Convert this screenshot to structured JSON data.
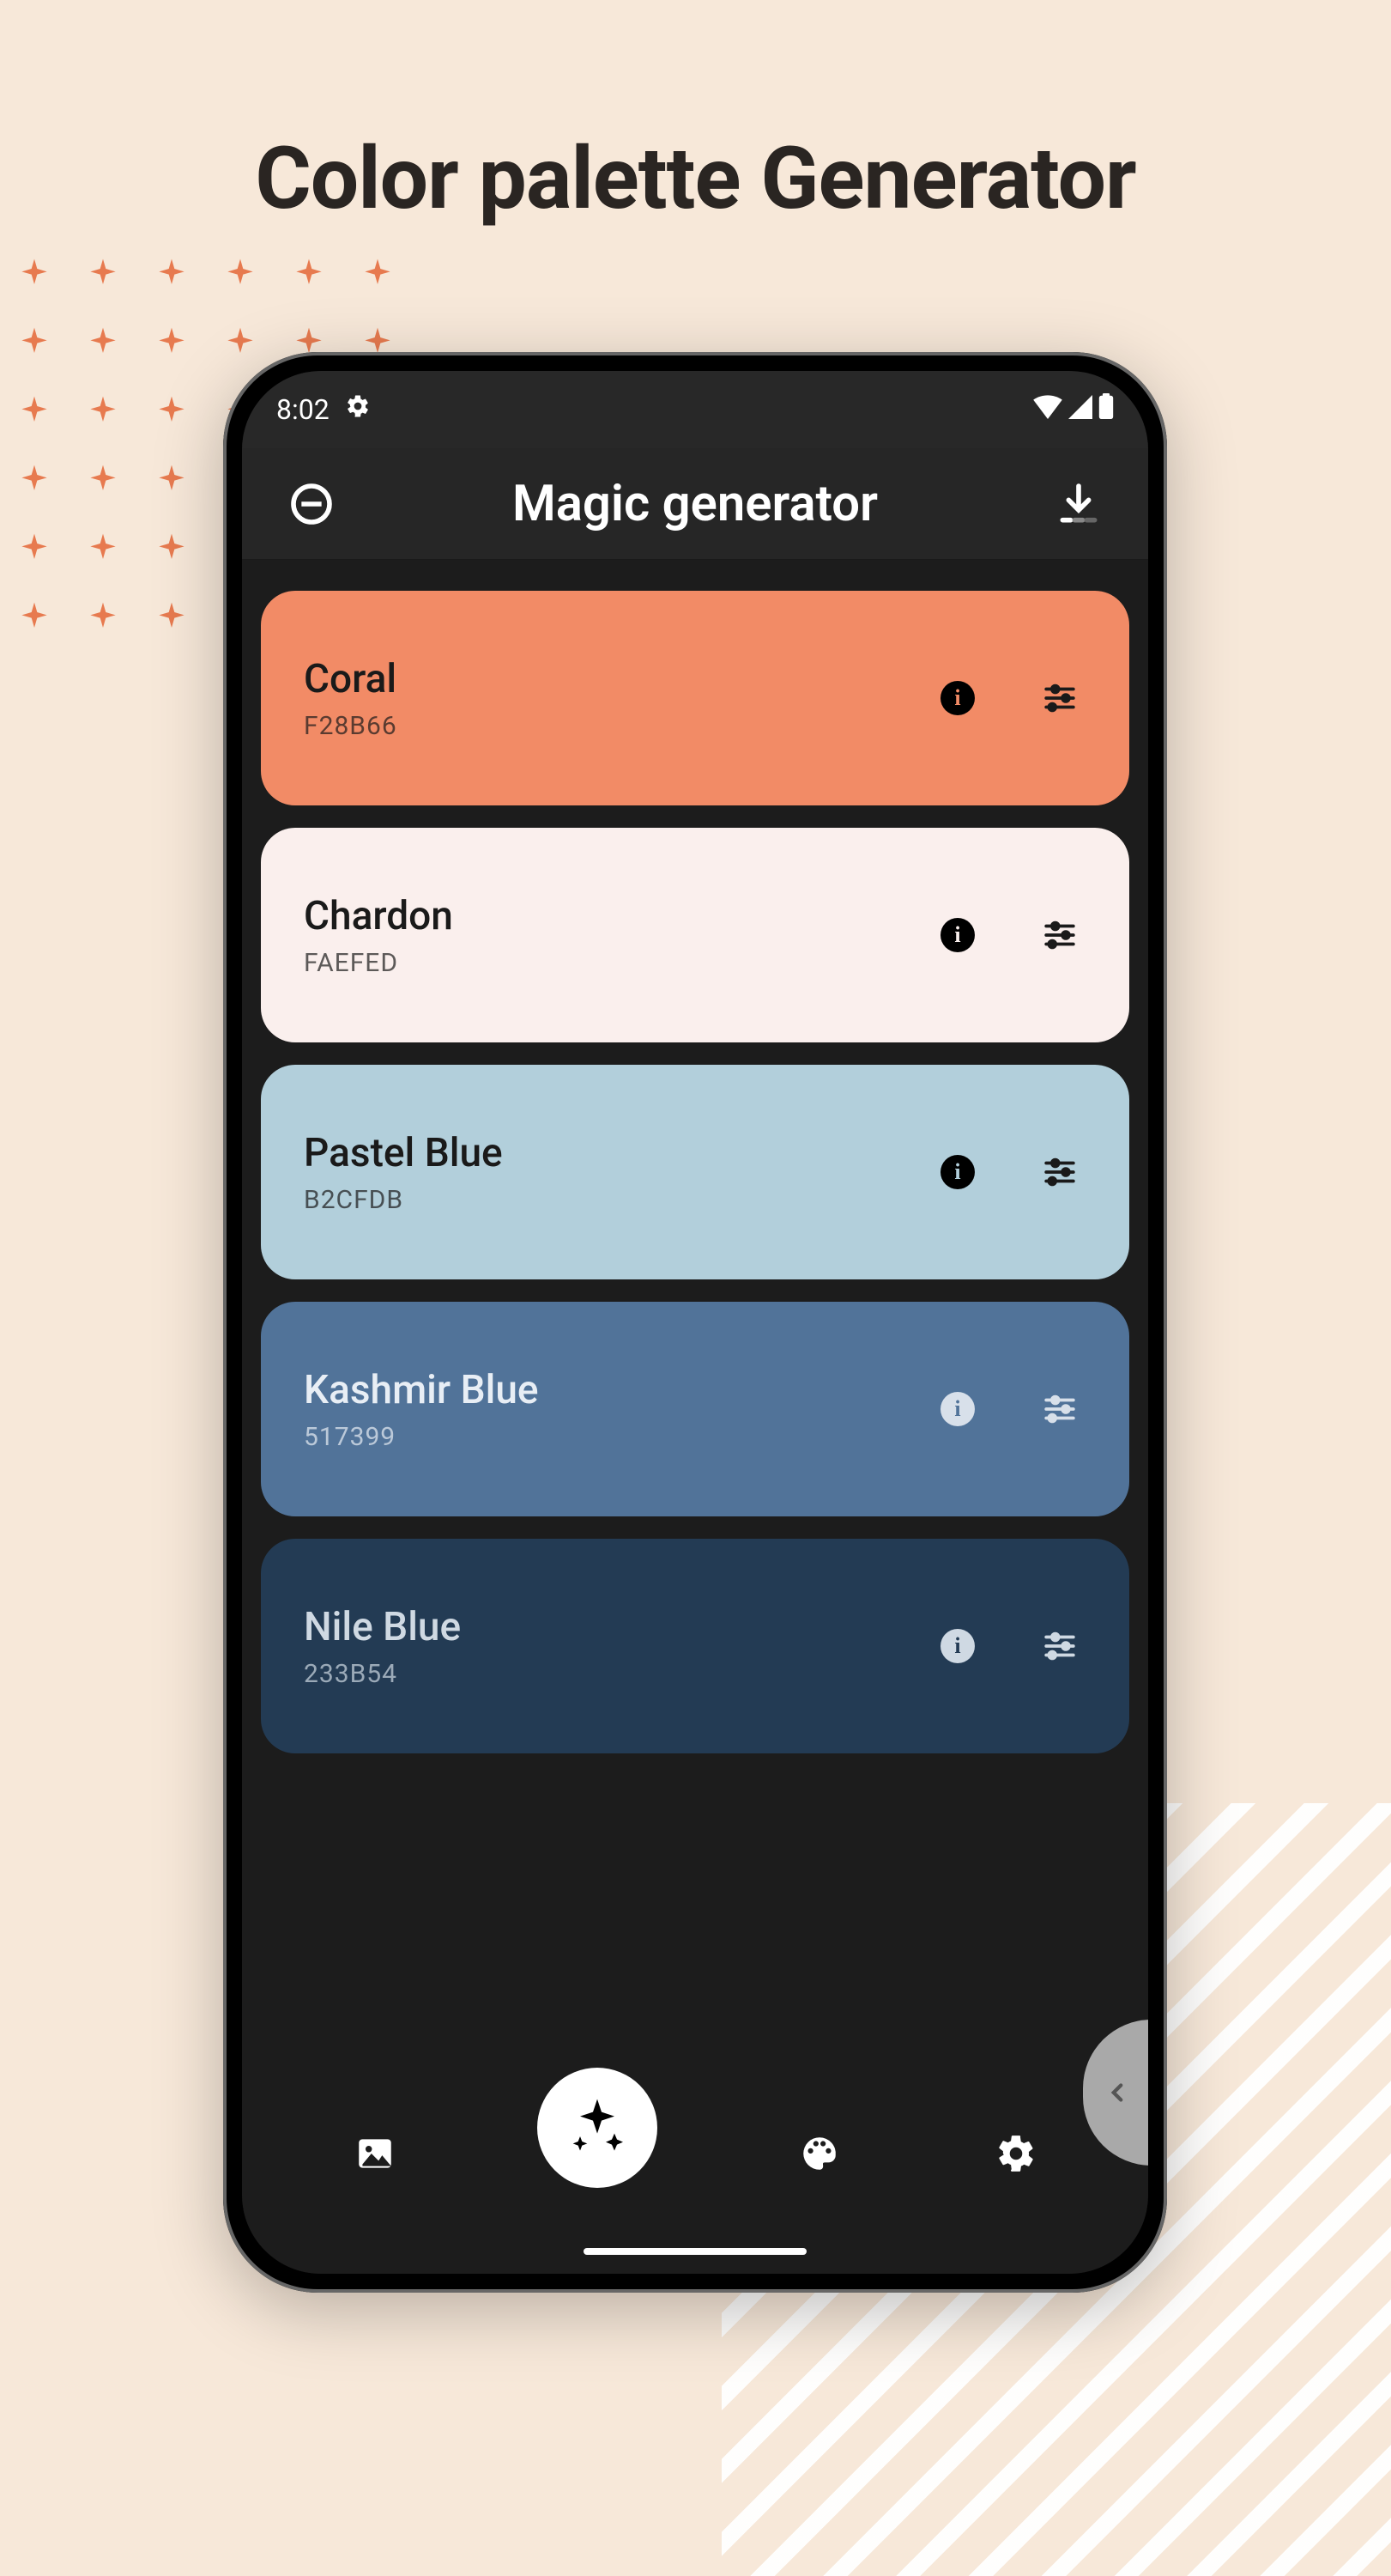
{
  "page": {
    "title": "Color palette Generator"
  },
  "status": {
    "time": "8:02"
  },
  "appbar": {
    "title": "Magic generator"
  },
  "colors": [
    {
      "name": "Coral",
      "hex": "F28B66",
      "bg": "#F28B66",
      "fg": "#1a1a1a",
      "info_bg": "#000",
      "info_fg": "#F28B66",
      "tune": "#1a1a1a"
    },
    {
      "name": "Chardon",
      "hex": "FAEFED",
      "bg": "#FAEFED",
      "fg": "#1a1a1a",
      "info_bg": "#000",
      "info_fg": "#FAEFED",
      "tune": "#1a1a1a"
    },
    {
      "name": "Pastel Blue",
      "hex": "B2CFDB",
      "bg": "#B2CFDB",
      "fg": "#1a1a1a",
      "info_bg": "#000",
      "info_fg": "#B2CFDB",
      "tune": "#1a1a1a"
    },
    {
      "name": "Kashmir Blue",
      "hex": "517399",
      "bg": "#517399",
      "fg": "#e8eef5",
      "info_bg": "#d8e0ea",
      "info_fg": "#517399",
      "tune": "#d8e0ea"
    },
    {
      "name": "Nile Blue",
      "hex": "233B54",
      "bg": "#233B54",
      "fg": "#cfd9e3",
      "info_bg": "#cfd9e3",
      "info_fg": "#233B54",
      "tune": "#cfd9e3"
    }
  ],
  "nav": {
    "items": [
      "gallery",
      "magic",
      "palette",
      "settings"
    ],
    "active": "magic"
  }
}
